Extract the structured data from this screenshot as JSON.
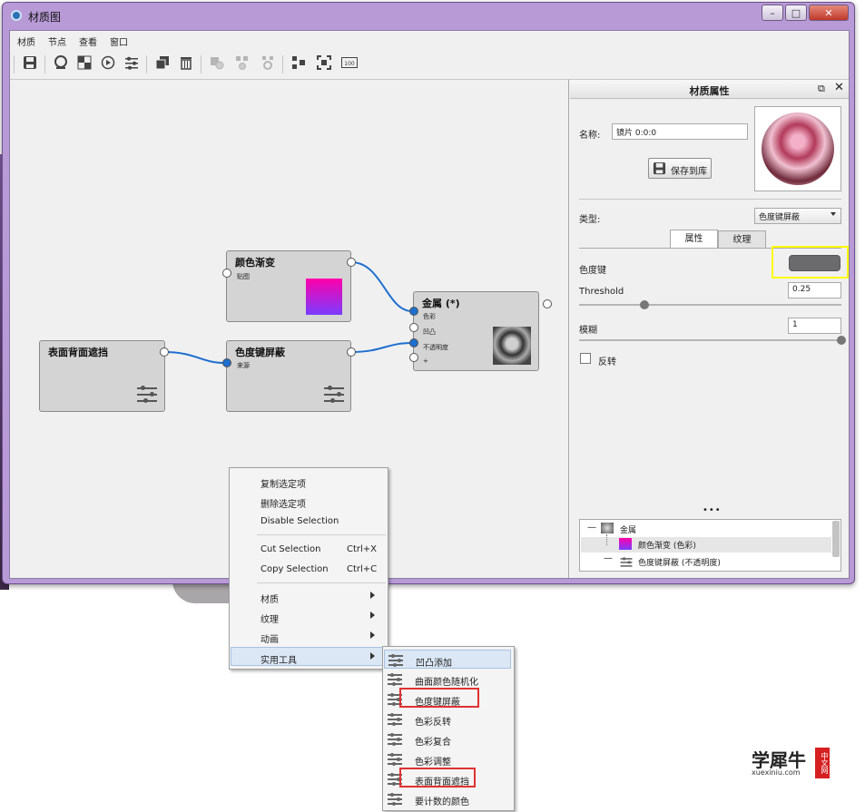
{
  "window": {
    "title": "材质图"
  },
  "menu": [
    "材质",
    "节点",
    "查看",
    "窗口"
  ],
  "toolbar_icons": [
    "save-icon",
    "sphere-icon",
    "checker-icon",
    "play-icon",
    "sliders-icon",
    "copy-icon",
    "trash-icon",
    "node-add-icon",
    "node-remove-icon",
    "node-refresh-icon",
    "layout-icon",
    "fit-icon",
    "frame-icon",
    "zoom-100-icon"
  ],
  "toolbar_zoom_label": "100",
  "nodes": {
    "gradient": {
      "title": "颜色渐变",
      "ports": [
        "贴图"
      ]
    },
    "metal": {
      "title": "金属 (*)",
      "ports": [
        "色彩",
        "凹凸",
        "不透明度",
        "+"
      ]
    },
    "colorkey": {
      "title": "色度键屏蔽",
      "ports": [
        "来源"
      ]
    },
    "backface": {
      "title": "表面背面遮挡"
    }
  },
  "panel": {
    "title": "材质属性",
    "name_label": "名称:",
    "name_value": "镜片 0:0:0",
    "save_button": "保存到库",
    "type_label": "类型:",
    "type_value": "色度键屏蔽",
    "tabs": [
      "属性",
      "纹理"
    ],
    "colorkey_label": "色度键",
    "colorkey_color": "#6b6b6e",
    "threshold_label": "Threshold",
    "threshold_value": "0.25",
    "threshold_level": 0.25,
    "blur_label": "模糊",
    "blur_value": "1",
    "blur_level": 1.0,
    "invert_label": "反转",
    "tree": {
      "root": "金属",
      "children": [
        "颜色渐变 (色彩)",
        "色度键屏蔽 (不透明度)"
      ]
    }
  },
  "context_menu": {
    "items": [
      {
        "label": "复制选定项",
        "shortcut": ""
      },
      {
        "label": "删除选定项",
        "shortcut": ""
      },
      {
        "label": "Disable Selection",
        "shortcut": ""
      },
      {
        "label": "Cut Selection",
        "shortcut": "Ctrl+X"
      },
      {
        "label": "Copy Selection",
        "shortcut": "Ctrl+C"
      },
      {
        "label": "材质",
        "shortcut": ""
      },
      {
        "label": "纹理",
        "shortcut": ""
      },
      {
        "label": "动画",
        "shortcut": ""
      },
      {
        "label": "实用工具",
        "shortcut": ""
      }
    ],
    "submenu": [
      "凹凸添加",
      "曲面颜色随机化",
      "色度键屏蔽",
      "色彩反转",
      "色彩复合",
      "色彩调整",
      "表面背面遮挡",
      "要计数的颜色"
    ]
  },
  "watermark": {
    "text": "学犀牛",
    "site": "xuexiniu.com",
    "side": "中文网"
  },
  "colors": {
    "accent": "#1e6fcf",
    "highlight": "#ffff00",
    "redbox": "#e03131",
    "titlebar": "#b79ad6"
  }
}
